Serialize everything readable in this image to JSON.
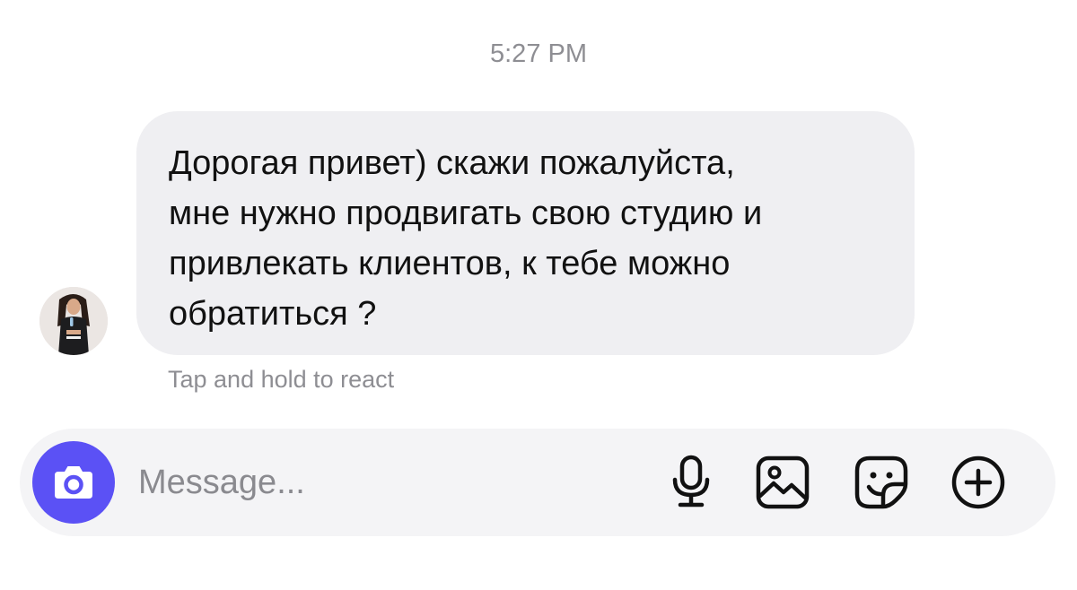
{
  "chat": {
    "timestamp": "5:27 PM",
    "message": {
      "text": "Дорогая привет) скажи пожалуйста,\nмне нужно продвигать свою студию и\nпривлекать клиентов, к тебе можно\nобратиться ?",
      "sender_avatar_icon": "profile-photo"
    },
    "react_hint": "Tap and hold to react"
  },
  "composer": {
    "placeholder": "Message...",
    "value": "",
    "camera_icon": "camera-icon",
    "tools": [
      {
        "icon": "microphone-icon"
      },
      {
        "icon": "gallery-icon"
      },
      {
        "icon": "sticker-icon"
      },
      {
        "icon": "plus-circle-icon"
      }
    ]
  },
  "colors": {
    "accent": "#5b51f5",
    "bubble_bg": "#efeff2",
    "composer_bg": "#f4f4f6",
    "muted_text": "#8e8e93"
  }
}
